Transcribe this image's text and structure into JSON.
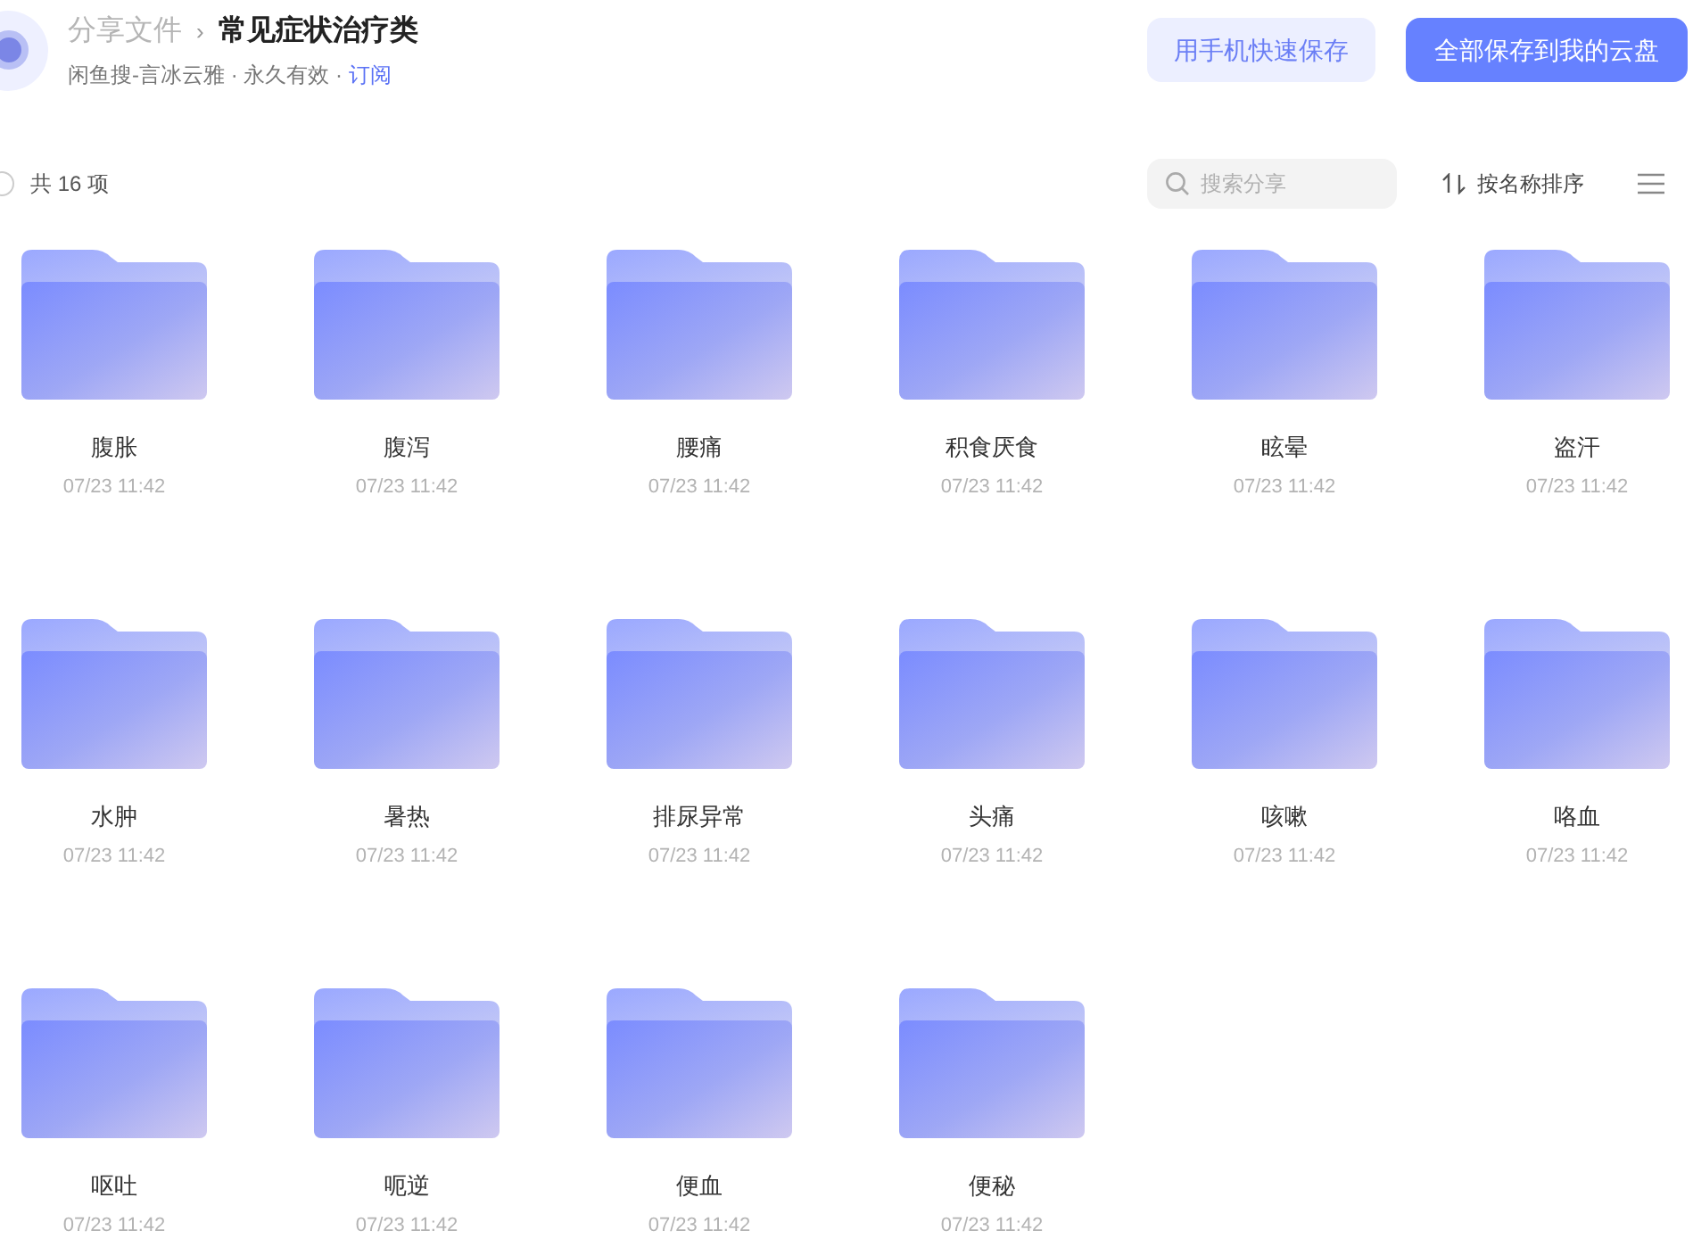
{
  "header": {
    "breadcrumb_parent": "分享文件",
    "breadcrumb_separator": "›",
    "title": "常见症状治疗类",
    "meta": "闲鱼搜-言冰云雅 · 永久有效 · ",
    "subscribe_link": "订阅",
    "buttons": [
      {
        "label": "用手机快速保存",
        "kind": "secondary"
      },
      {
        "label": "全部保存到我的云盘",
        "kind": "primary"
      }
    ]
  },
  "toolbar": {
    "select_all": {
      "checked": false
    },
    "count": "共 16 项",
    "search": {
      "placeholder": "搜索分享"
    },
    "sort": "按名称排序"
  },
  "files": [
    {
      "name": "腹胀",
      "date": "07/23 11:42"
    },
    {
      "name": "腹泻",
      "date": "07/23 11:42"
    },
    {
      "name": "腰痛",
      "date": "07/23 11:42"
    },
    {
      "name": "积食厌食",
      "date": "07/23 11:42"
    },
    {
      "name": "眩晕",
      "date": "07/23 11:42"
    },
    {
      "name": "盗汗",
      "date": "07/23 11:42"
    },
    {
      "name": "水肿",
      "date": "07/23 11:42"
    },
    {
      "name": "暑热",
      "date": "07/23 11:42"
    },
    {
      "name": "排尿异常",
      "date": "07/23 11:42"
    },
    {
      "name": "头痛",
      "date": "07/23 11:42"
    },
    {
      "name": "咳嗽",
      "date": "07/23 11:42"
    },
    {
      "name": "咯血",
      "date": "07/23 11:42"
    },
    {
      "name": "呕吐",
      "date": "07/23 11:42"
    },
    {
      "name": "呃逆",
      "date": "07/23 11:42"
    },
    {
      "name": "便血",
      "date": "07/23 11:42"
    },
    {
      "name": "便秘",
      "date": "07/23 11:42"
    }
  ]
}
